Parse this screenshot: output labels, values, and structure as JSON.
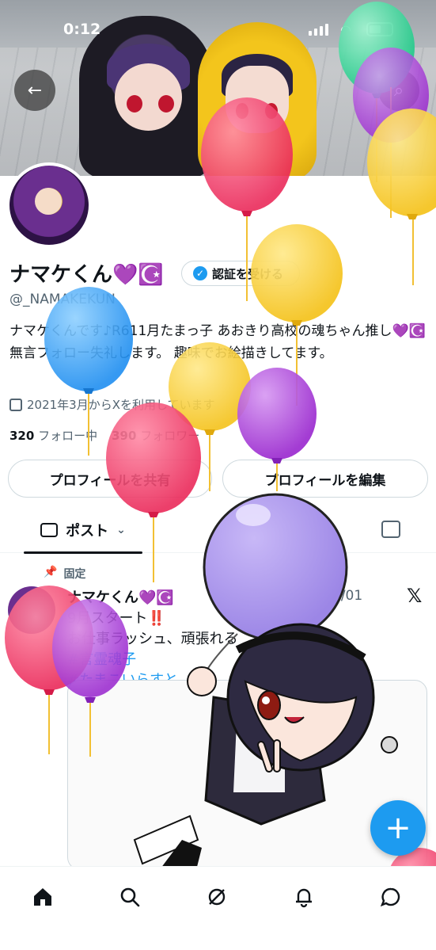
{
  "status_bar": {
    "time": "0:12"
  },
  "profile": {
    "display_name": "ナマケくん💜☪️",
    "verify_label": "認証を受ける",
    "handle": "@_NAMAKEKUN",
    "bio": "ナマケくんです♪R611月たまっ子 あおきり高校の魂ちゃん推し💜☪️ 無言フォロー失礼します。 趣味でお絵描きしてます。",
    "joined": "2021年3月からXを利用しています",
    "following_count": "320",
    "following_label": "フォロー中",
    "followers_count": "390",
    "followers_label": "フォロワー"
  },
  "buttons": {
    "share": "プロフィールを共有",
    "edit": "プロフィールを編集"
  },
  "tabs": {
    "posts": "ポスト"
  },
  "pinned_post": {
    "pinned_label": "固定",
    "author": "ナマケくん💜☪️",
    "date": "9/01",
    "line1": "9月スタート‼️",
    "line2": "お仕事ラッシュ、頑張れる",
    "hashtag1": "#言霊魂子",
    "hashtag2": "#たまこいらすと"
  },
  "icons": {
    "back": "arrow-left-icon",
    "search": "search-icon",
    "home": "home-icon",
    "grok": "grok-icon",
    "notifications": "bell-icon",
    "messages": "message-icon",
    "compose": "plus-icon"
  },
  "colors": {
    "accent": "#1d9bf0",
    "text": "#0f1419",
    "secondary": "#536471"
  }
}
